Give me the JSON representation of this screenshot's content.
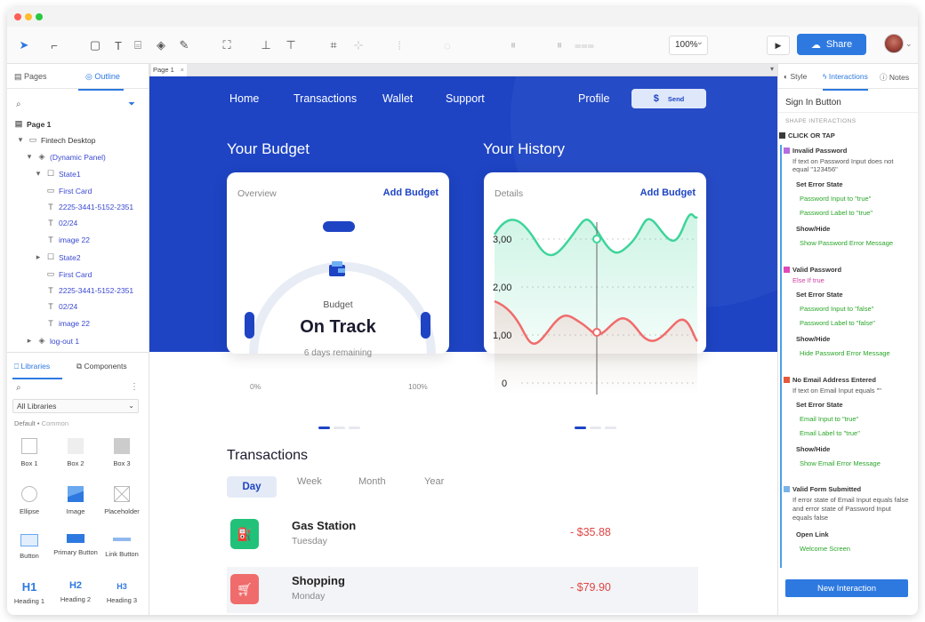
{
  "toolbar": {
    "zoom": "100%",
    "share_label": "Share"
  },
  "left_panel": {
    "tabs": [
      "Pages",
      "Outline"
    ],
    "tree": [
      {
        "label": "Page 1",
        "bold": true
      },
      {
        "label": "Fintech Desktop"
      },
      {
        "label": "(Dynamic Panel)"
      },
      {
        "label": "State1"
      },
      {
        "label": "First Card"
      },
      {
        "label": "2225-3441-5152-2351"
      },
      {
        "label": "02/24"
      },
      {
        "label": "image 22"
      },
      {
        "label": "State2"
      },
      {
        "label": "First Card"
      },
      {
        "label": "2225-3441-5152-2351"
      },
      {
        "label": "02/24"
      },
      {
        "label": "image 22"
      },
      {
        "label": "log-out 1"
      }
    ],
    "lib_tabs": [
      "Libraries",
      "Components"
    ],
    "library_select": "All Libraries",
    "library_group": "Default",
    "library_subgroup": "Common",
    "shapes": [
      "Box 1",
      "Box 2",
      "Box 3",
      "Ellipse",
      "Image",
      "Placeholder",
      "Button",
      "Primary Button",
      "Link Button",
      "Heading 1",
      "Heading 2",
      "Heading 3"
    ]
  },
  "canvas": {
    "page_tab": "Page 1",
    "nav": [
      "Home",
      "Transactions",
      "Wallet",
      "Support"
    ],
    "profile": "Profile",
    "send": "Send",
    "budget_title": "Your Budget",
    "history_title": "Your History",
    "budget_card": {
      "label": "Overview",
      "action": "Add Budget",
      "caption": "Budget",
      "status": "On Track",
      "remaining": "6 days remaining",
      "min": "0%",
      "max": "100%"
    },
    "history_card": {
      "label": "Details",
      "action": "Add Budget",
      "y_ticks": [
        "3,00",
        "2,00",
        "1,00",
        "0"
      ]
    },
    "transactions_title": "Transactions",
    "periods": [
      "Day",
      "Week",
      "Month",
      "Year"
    ],
    "transactions": [
      {
        "name": "Gas Station",
        "day": "Tuesday",
        "amount": "- $35.88",
        "color": "#22c17a"
      },
      {
        "name": "Shopping",
        "day": "Monday",
        "amount": "- $79.90",
        "color": "#f06b6b"
      }
    ]
  },
  "right_panel": {
    "tabs": [
      "Style",
      "Interactions",
      "Notes"
    ],
    "selected": "Sign In Button",
    "section": "SHAPE INTERACTIONS",
    "event": "CLICK OR TAP",
    "cases": [
      {
        "title": "Invalid Password",
        "color": "#b46ee0",
        "cond": "If text on Password Input does not equal \"123456\"",
        "actions": [
          {
            "head": "Set Error State",
            "items": [
              "Password Input to \"true\"",
              "Password Label to \"true\""
            ]
          },
          {
            "head": "Show/Hide",
            "items": [
              "Show Password Error Message"
            ]
          }
        ]
      },
      {
        "title": "Valid Password",
        "color": "#e04ab8",
        "cond": "Else If true",
        "actions": [
          {
            "head": "Set Error State",
            "items": [
              "Password Input to \"false\"",
              "Password Label to \"false\""
            ]
          },
          {
            "head": "Show/Hide",
            "items": [
              "Hide Password Error Message"
            ]
          }
        ]
      },
      {
        "title": "No Email Address Entered",
        "color": "#e45a3c",
        "cond": "If text on Email Input equals \"\"",
        "actions": [
          {
            "head": "Set Error State",
            "items": [
              "Email Input to \"true\"",
              "Email Label to \"true\""
            ]
          },
          {
            "head": "Show/Hide",
            "items": [
              "Show Email Error Message"
            ]
          }
        ]
      },
      {
        "title": "Valid Form Submitted",
        "color": "#7bb3e8",
        "cond": "If error state of Email Input equals false and error state of Password Input equals false",
        "actions": [
          {
            "head": "Open Link",
            "items": [
              "Welcome Screen"
            ]
          }
        ]
      }
    ],
    "new_button": "New Interaction"
  }
}
